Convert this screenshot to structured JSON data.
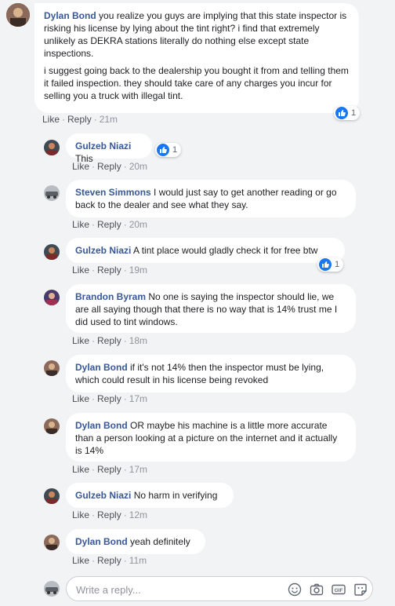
{
  "thread": {
    "main": {
      "name": "Dylan Bond",
      "p1": "you realize you guys are implying that this state inspector is risking his license by lying about the tint right? i find that extremely unlikely as DEKRA stations literally do nothing else except state inspections.",
      "p2": "i suggest going back to the dealership you bought it from and telling them it failed inspection. they should take care of any charges you incur for selling you a truck with illegal tint.",
      "like": "Like",
      "reply": "Reply",
      "time": "21m",
      "reactions": "1"
    },
    "replies": [
      {
        "name": "Gulzeb Niazi",
        "text": "This",
        "like": "Like",
        "reply": "Reply",
        "time": "20m",
        "reactions": "1"
      },
      {
        "name": "Steven Simmons",
        "text": "I would just say to get another reading or go back to the dealer and see what they say.",
        "like": "Like",
        "reply": "Reply",
        "time": "20m"
      },
      {
        "name": "Gulzeb Niazi",
        "text": "A tint place would gladly check it for free btw",
        "like": "Like",
        "reply": "Reply",
        "time": "19m",
        "reactions": "1"
      },
      {
        "name": "Brandon Byram",
        "text": "No one is saying the inspector should lie, we are all saying though that there is no way that is 14% trust me I did used to tint windows.",
        "like": "Like",
        "reply": "Reply",
        "time": "18m"
      },
      {
        "name": "Dylan Bond",
        "text": "if it's not 14% then the inspector must be lying, which could result in his license being revoked",
        "like": "Like",
        "reply": "Reply",
        "time": "17m"
      },
      {
        "name": "Dylan Bond",
        "text": "OR maybe his machine is a little more accurate than a person looking at a picture on the internet and it actually is 14%",
        "like": "Like",
        "reply": "Reply",
        "time": "17m"
      },
      {
        "name": "Gulzeb Niazi",
        "text": "No harm in verifying",
        "like": "Like",
        "reply": "Reply",
        "time": "12m"
      },
      {
        "name": "Dylan Bond",
        "text": "yeah definitely",
        "like": "Like",
        "reply": "Reply",
        "time": "11m"
      }
    ]
  },
  "reply_box": {
    "placeholder": "Write a reply...",
    "icons": [
      "emoji-icon",
      "camera-icon",
      "gif-icon",
      "sticker-icon"
    ]
  },
  "colors": {
    "name": "#385898",
    "like_badge": "#1877f2",
    "background": "#f2f3f5"
  }
}
